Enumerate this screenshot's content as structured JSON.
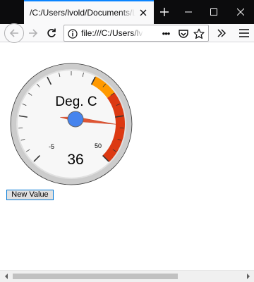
{
  "browser": {
    "tab_title": "/C:/Users/lvold/Documents/Lucste",
    "url": "file:///C:/Users/lv",
    "page_actions_label": "•••"
  },
  "icons": {
    "tab_close": "close-icon",
    "new_tab": "plus-icon",
    "minimize": "minimize-icon",
    "maximize": "maximize-icon",
    "close_window": "close-icon",
    "back": "back-arrow-icon",
    "forward": "forward-arrow-icon",
    "reload": "reload-icon",
    "site_info": "info-icon",
    "pocket": "pocket-icon",
    "bookmark": "star-icon",
    "overflow": "chevron-double-right-icon",
    "menu": "hamburger-menu-icon"
  },
  "gauge": {
    "label": "Deg. C",
    "value": 36,
    "value_text": "36",
    "min": -50,
    "max": 50,
    "min_label": "-5",
    "max_label": "50",
    "yellow_band": [
      10,
      20
    ],
    "red_band": [
      20,
      50
    ],
    "colors": {
      "yellow": "#ff9900",
      "red": "#dc3912",
      "needle": "#dc3912",
      "hub": "#4684ee",
      "rim": "#cccccc",
      "face": "#f7f7f7"
    }
  },
  "controls": {
    "new_value_label": "New Value"
  }
}
